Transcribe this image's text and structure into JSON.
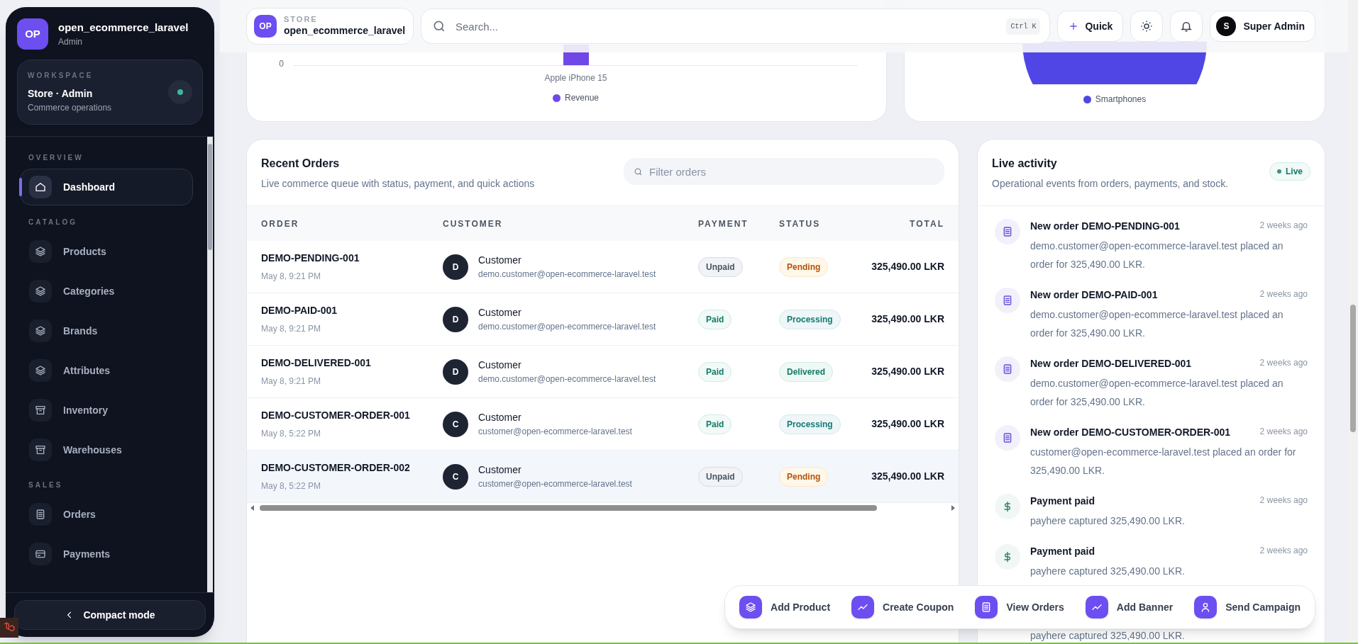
{
  "sidebar": {
    "brand": {
      "initials": "OP",
      "name": "open_ecommerce_laravel",
      "role": "Admin"
    },
    "workspace": {
      "label": "WORKSPACE",
      "title": "Store · Admin",
      "subtitle": "Commerce operations"
    },
    "sections": [
      {
        "title": "OVERVIEW",
        "items": [
          {
            "label": "Dashboard",
            "kind": "home",
            "selected": true
          }
        ]
      },
      {
        "title": "CATALOG",
        "items": [
          {
            "label": "Products",
            "kind": "layers",
            "selected": false
          },
          {
            "label": "Categories",
            "kind": "layers",
            "selected": false
          },
          {
            "label": "Brands",
            "kind": "layers",
            "selected": false
          },
          {
            "label": "Attributes",
            "kind": "layers",
            "selected": false
          },
          {
            "label": "Inventory",
            "kind": "box",
            "selected": false
          },
          {
            "label": "Warehouses",
            "kind": "box",
            "selected": false
          }
        ]
      },
      {
        "title": "SALES",
        "items": [
          {
            "label": "Orders",
            "kind": "document",
            "selected": false
          },
          {
            "label": "Payments",
            "kind": "card",
            "selected": false
          }
        ]
      }
    ],
    "compact_button": {
      "label": "Compact mode"
    }
  },
  "topbar": {
    "store": {
      "initials": "OP",
      "label": "STORE",
      "name": "open_ecommerce_laravel"
    },
    "search": {
      "placeholder": "Search...",
      "shortcut": "Ctrl K"
    },
    "quick_button": "Quick",
    "user": {
      "initial": "S",
      "name": "Super Admin"
    }
  },
  "charts": [
    {
      "axis_tick": "0",
      "category": "Apple iPhone 15",
      "legend": "Revenue",
      "color": "#7048e8"
    },
    {
      "legend": "Smartphones",
      "color": "#4f46e5"
    }
  ],
  "orders": {
    "title": "Recent Orders",
    "subtitle": "Live commerce queue with status, payment, and quick actions",
    "filter": {
      "placeholder": "Filter orders"
    },
    "columns": [
      "ORDER",
      "CUSTOMER",
      "PAYMENT",
      "STATUS",
      "TOTAL"
    ],
    "rows": [
      {
        "order": "DEMO-PENDING-001",
        "date": "May 8, 9:21 PM",
        "initial": "D",
        "customer": "Customer",
        "email": "demo.customer@open-ecommerce-laravel.test",
        "payment": {
          "label": "Unpaid",
          "kind": "unpaid"
        },
        "status": {
          "label": "Pending",
          "kind": "pending"
        },
        "total": "325,490.00 LKR",
        "selected": false
      },
      {
        "order": "DEMO-PAID-001",
        "date": "May 8, 9:21 PM",
        "initial": "D",
        "customer": "Customer",
        "email": "demo.customer@open-ecommerce-laravel.test",
        "payment": {
          "label": "Paid",
          "kind": "paid"
        },
        "status": {
          "label": "Processing",
          "kind": "processing"
        },
        "total": "325,490.00 LKR",
        "selected": false
      },
      {
        "order": "DEMO-DELIVERED-001",
        "date": "May 8, 9:21 PM",
        "initial": "D",
        "customer": "Customer",
        "email": "demo.customer@open-ecommerce-laravel.test",
        "payment": {
          "label": "Paid",
          "kind": "paid"
        },
        "status": {
          "label": "Delivered",
          "kind": "delivered"
        },
        "total": "325,490.00 LKR",
        "selected": false
      },
      {
        "order": "DEMO-CUSTOMER-ORDER-001",
        "date": "May 8, 5:22 PM",
        "initial": "C",
        "customer": "Customer",
        "email": "customer@open-ecommerce-laravel.test",
        "payment": {
          "label": "Paid",
          "kind": "paid"
        },
        "status": {
          "label": "Processing",
          "kind": "processing"
        },
        "total": "325,490.00 LKR",
        "selected": false
      },
      {
        "order": "DEMO-CUSTOMER-ORDER-002",
        "date": "May 8, 5:22 PM",
        "initial": "C",
        "customer": "Customer",
        "email": "customer@open-ecommerce-laravel.test",
        "payment": {
          "label": "Unpaid",
          "kind": "unpaid"
        },
        "status": {
          "label": "Pending",
          "kind": "pending"
        },
        "total": "325,490.00 LKR",
        "selected": true
      }
    ]
  },
  "activity": {
    "title": "Live activity",
    "subtitle": "Operational events from orders, payments, and stock.",
    "badge": "Live",
    "items": [
      {
        "kind": "order",
        "title": "New order DEMO-PENDING-001",
        "time": "2 weeks ago",
        "description": "demo.customer@open-ecommerce-laravel.test placed an order for 325,490.00 LKR."
      },
      {
        "kind": "order",
        "title": "New order DEMO-PAID-001",
        "time": "2 weeks ago",
        "description": "demo.customer@open-ecommerce-laravel.test placed an order for 325,490.00 LKR."
      },
      {
        "kind": "order",
        "title": "New order DEMO-DELIVERED-001",
        "time": "2 weeks ago",
        "description": "demo.customer@open-ecommerce-laravel.test placed an order for 325,490.00 LKR."
      },
      {
        "kind": "order",
        "title": "New order DEMO-CUSTOMER-ORDER-001",
        "time": "2 weeks ago",
        "description": "customer@open-ecommerce-laravel.test placed an order for 325,490.00 LKR."
      },
      {
        "kind": "payment",
        "title": "Payment paid",
        "time": "2 weeks ago",
        "description": "payhere captured 325,490.00 LKR."
      },
      {
        "kind": "payment",
        "title": "Payment paid",
        "time": "2 weeks ago",
        "description": "payhere captured 325,490.00 LKR."
      },
      {
        "kind": "payment",
        "description": "payhere captured 325,490.00 LKR."
      }
    ]
  },
  "quick_actions": [
    {
      "label": "Add Product",
      "kind": "layers"
    },
    {
      "label": "Create Coupon",
      "kind": "trend"
    },
    {
      "label": "View Orders",
      "kind": "document"
    },
    {
      "label": "Add Banner",
      "kind": "trend"
    },
    {
      "label": "Send Campaign",
      "kind": "user"
    }
  ]
}
